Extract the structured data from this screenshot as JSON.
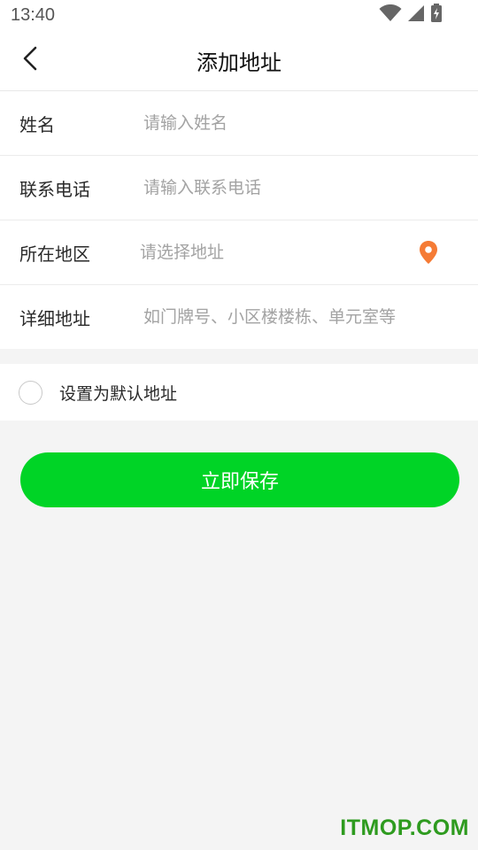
{
  "status_bar": {
    "time": "13:40",
    "icons": [
      "wifi-icon",
      "signal-icon",
      "battery-charging-icon"
    ]
  },
  "header": {
    "back_icon": "chevron-left-icon",
    "title": "添加地址"
  },
  "form": {
    "name": {
      "label": "姓名",
      "placeholder": "请输入姓名",
      "value": ""
    },
    "phone": {
      "label": "联系电话",
      "placeholder": "请输入联系电话",
      "value": ""
    },
    "region": {
      "label": "所在地区",
      "placeholder": "请选择地址",
      "value": "",
      "icon": "location-pin-icon"
    },
    "detail": {
      "label": "详细地址",
      "placeholder": "如门牌号、小区楼楼栋、单元室等",
      "value": ""
    }
  },
  "default_option": {
    "label": "设置为默认地址",
    "checked": false
  },
  "save_button": {
    "label": "立即保存"
  },
  "watermark": "ITMOP.COM",
  "colors": {
    "accent_green": "#00d426",
    "pin_orange": "#f57b35",
    "watermark_green": "#2e9b1f",
    "background": "#f4f4f4"
  }
}
